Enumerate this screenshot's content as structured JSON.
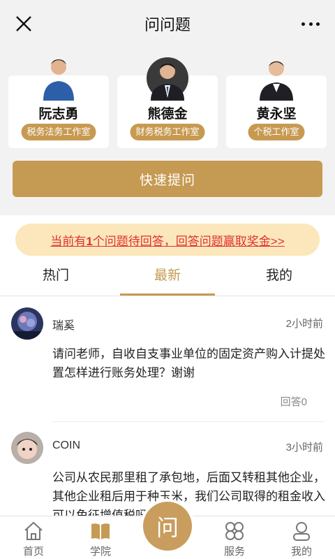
{
  "header": {
    "title": "问问题"
  },
  "experts": [
    {
      "name": "阮志勇",
      "tag": "税务法务工作室"
    },
    {
      "name": "熊德金",
      "tag": "财务税务工作室"
    },
    {
      "name": "黄永坚",
      "tag": "个税工作室"
    }
  ],
  "quick_ask_label": "快速提问",
  "notice": {
    "prefix": "当前有",
    "count": "1",
    "suffix": "个问题待回答，回答问题赢取奖金>>"
  },
  "tabs": [
    "热门",
    "最新",
    "我的"
  ],
  "active_tab": "最新",
  "questions": [
    {
      "user": "瑞奚",
      "time": "2小时前",
      "text": "请问老师，自收自支事业单位的固定资产购入计提处置怎样进行账务处理？谢谢",
      "answers": "回答0"
    },
    {
      "user": "COIN",
      "time": "3小时前",
      "text": "公司从农民那里租了承包地，后面又转租其他企业，其他企业租后用于种玉米，我们公司取得的租金收入可以免征增值税吗?",
      "answers": ""
    }
  ],
  "bottom_nav": [
    {
      "label": "首页",
      "icon": "home-icon"
    },
    {
      "label": "学院",
      "icon": "book-icon"
    },
    {
      "label": "问",
      "icon": "ask-icon"
    },
    {
      "label": "服务",
      "icon": "clover-icon"
    },
    {
      "label": "我的",
      "icon": "user-icon"
    }
  ],
  "colors": {
    "accent": "#c59a52",
    "notice_bg": "#fbe7bb",
    "notice_text": "#e0312f"
  }
}
